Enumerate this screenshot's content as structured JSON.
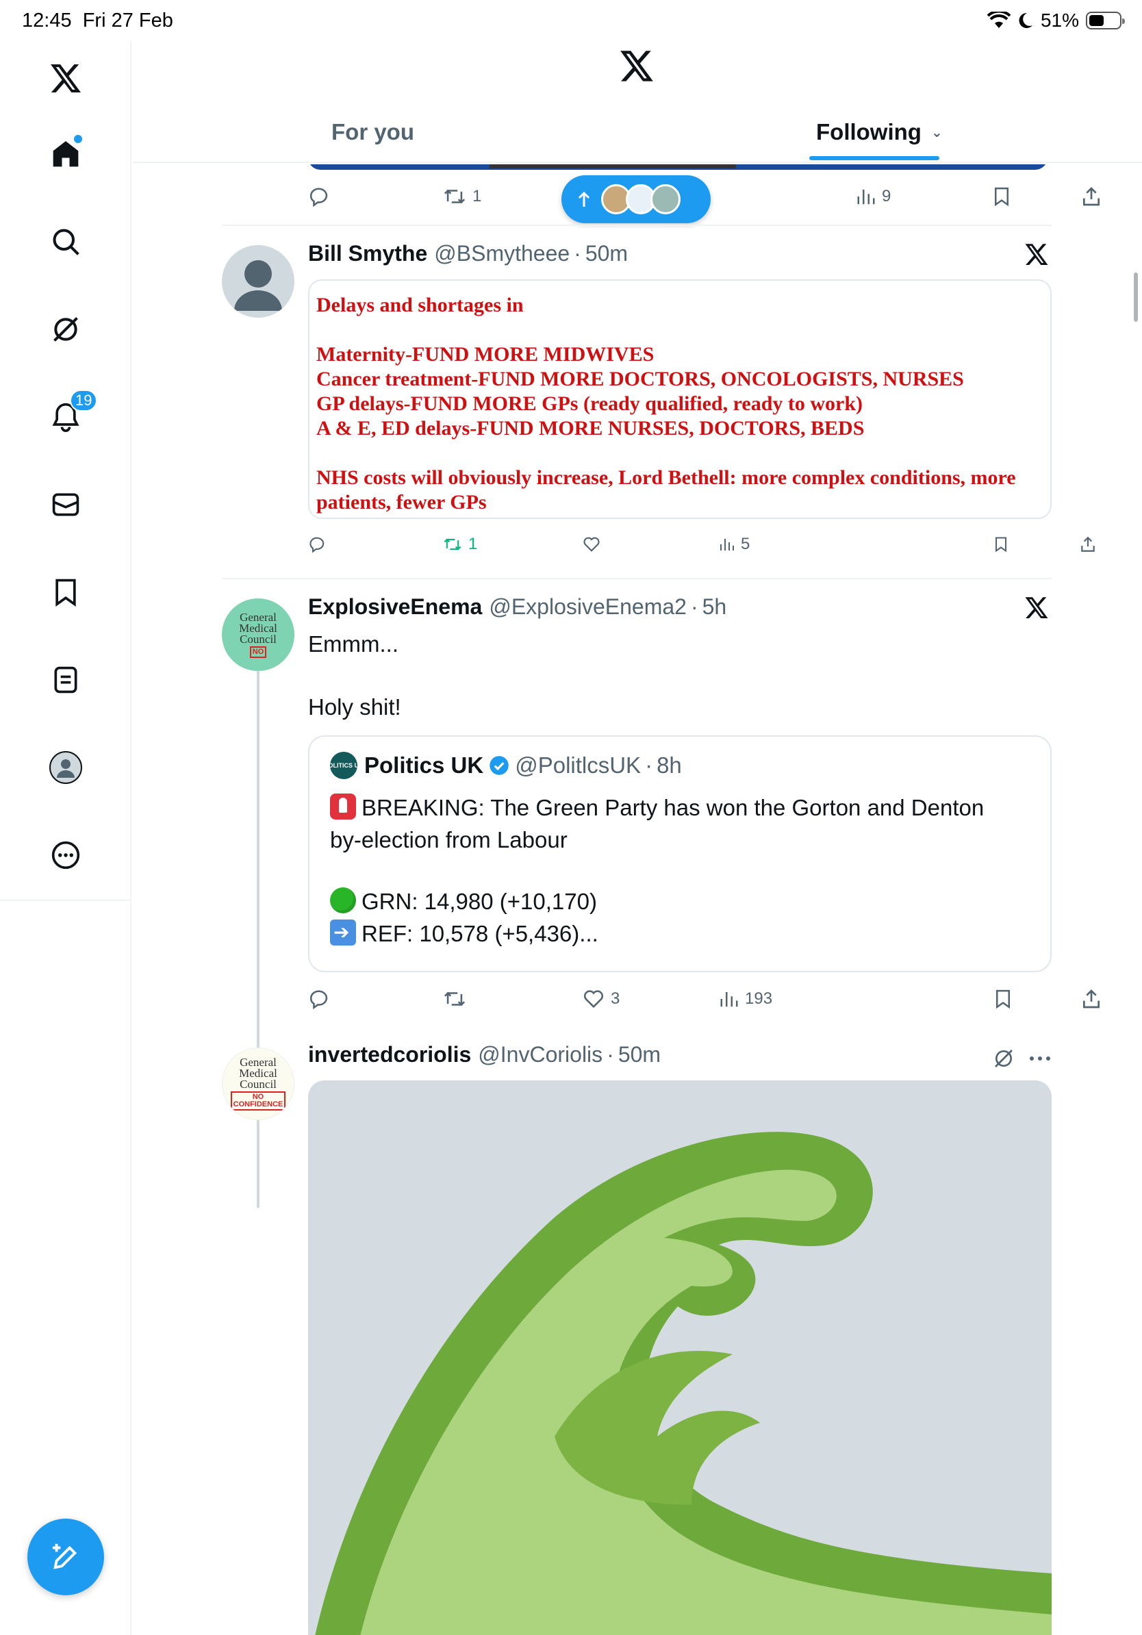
{
  "status_bar": {
    "time": "12:45",
    "date": "Fri 27 Feb",
    "battery": "51%",
    "battery_level": 0.51
  },
  "sidebar": {
    "items": [
      {
        "name": "x-logo-icon"
      },
      {
        "name": "home-icon"
      },
      {
        "name": "search-icon"
      },
      {
        "name": "grok-icon"
      },
      {
        "name": "notifications-icon",
        "badge": "19"
      },
      {
        "name": "messages-icon"
      },
      {
        "name": "bookmarks-icon"
      },
      {
        "name": "lists-icon"
      },
      {
        "name": "profile-icon"
      },
      {
        "name": "more-icon"
      }
    ],
    "compose_icon": "compose-icon"
  },
  "tabs": {
    "for_you": "For you",
    "following": "Following"
  },
  "colors": {
    "accent": "#1d9bf0",
    "repost_active": "#00ba7c",
    "doc_text": "#d01010"
  },
  "previous_post": {
    "actions": {
      "reposts": "1",
      "views": "9"
    }
  },
  "posts": [
    {
      "name": "Bill Smythe",
      "handle": "@BSmytheee",
      "time": "50m",
      "doc_lines": [
        "Delays and shortages in",
        "Maternity-FUND MORE MIDWIVES",
        "Cancer treatment-FUND MORE DOCTORS, ONCOLOGISTS, NURSES",
        "GP delays-FUND MORE GPs (ready qualified, ready to work)",
        "A & E, ED delays-FUND MORE NURSES, DOCTORS, BEDS",
        "NHS costs will obviously increase, Lord Bethell: more complex conditions, more patients, fewer GPs"
      ],
      "actions": {
        "reposts": "1",
        "views": "5"
      }
    },
    {
      "name": "ExplosiveEnema",
      "handle": "@ExplosiveEnema2",
      "time": "5h",
      "text_line1": "Emmm...",
      "text_line2": "Holy shit!",
      "quote": {
        "name": "Politics UK",
        "handle": "@PolitlcsUK",
        "time": "8h",
        "avatar_text": "POLITICS UK",
        "line1": "BREAKING: The Green Party has won the Gorton and Denton",
        "line2": "by-election from Labour",
        "line3": "GRN: 14,980 (+10,170)",
        "line4": "REF: 10,578 (+5,436)..."
      },
      "actions": {
        "likes": "3",
        "views": "193"
      }
    },
    {
      "name": "invertedcoriolis",
      "handle": "@InvCoriolis",
      "time": "50m"
    }
  ],
  "avatars": {
    "gmc_line1": "General",
    "gmc_line2": "Medical",
    "gmc_line3": "Council",
    "stamp_line1": "NO",
    "stamp_line2": "CONFIDENCE"
  },
  "separator": "·"
}
